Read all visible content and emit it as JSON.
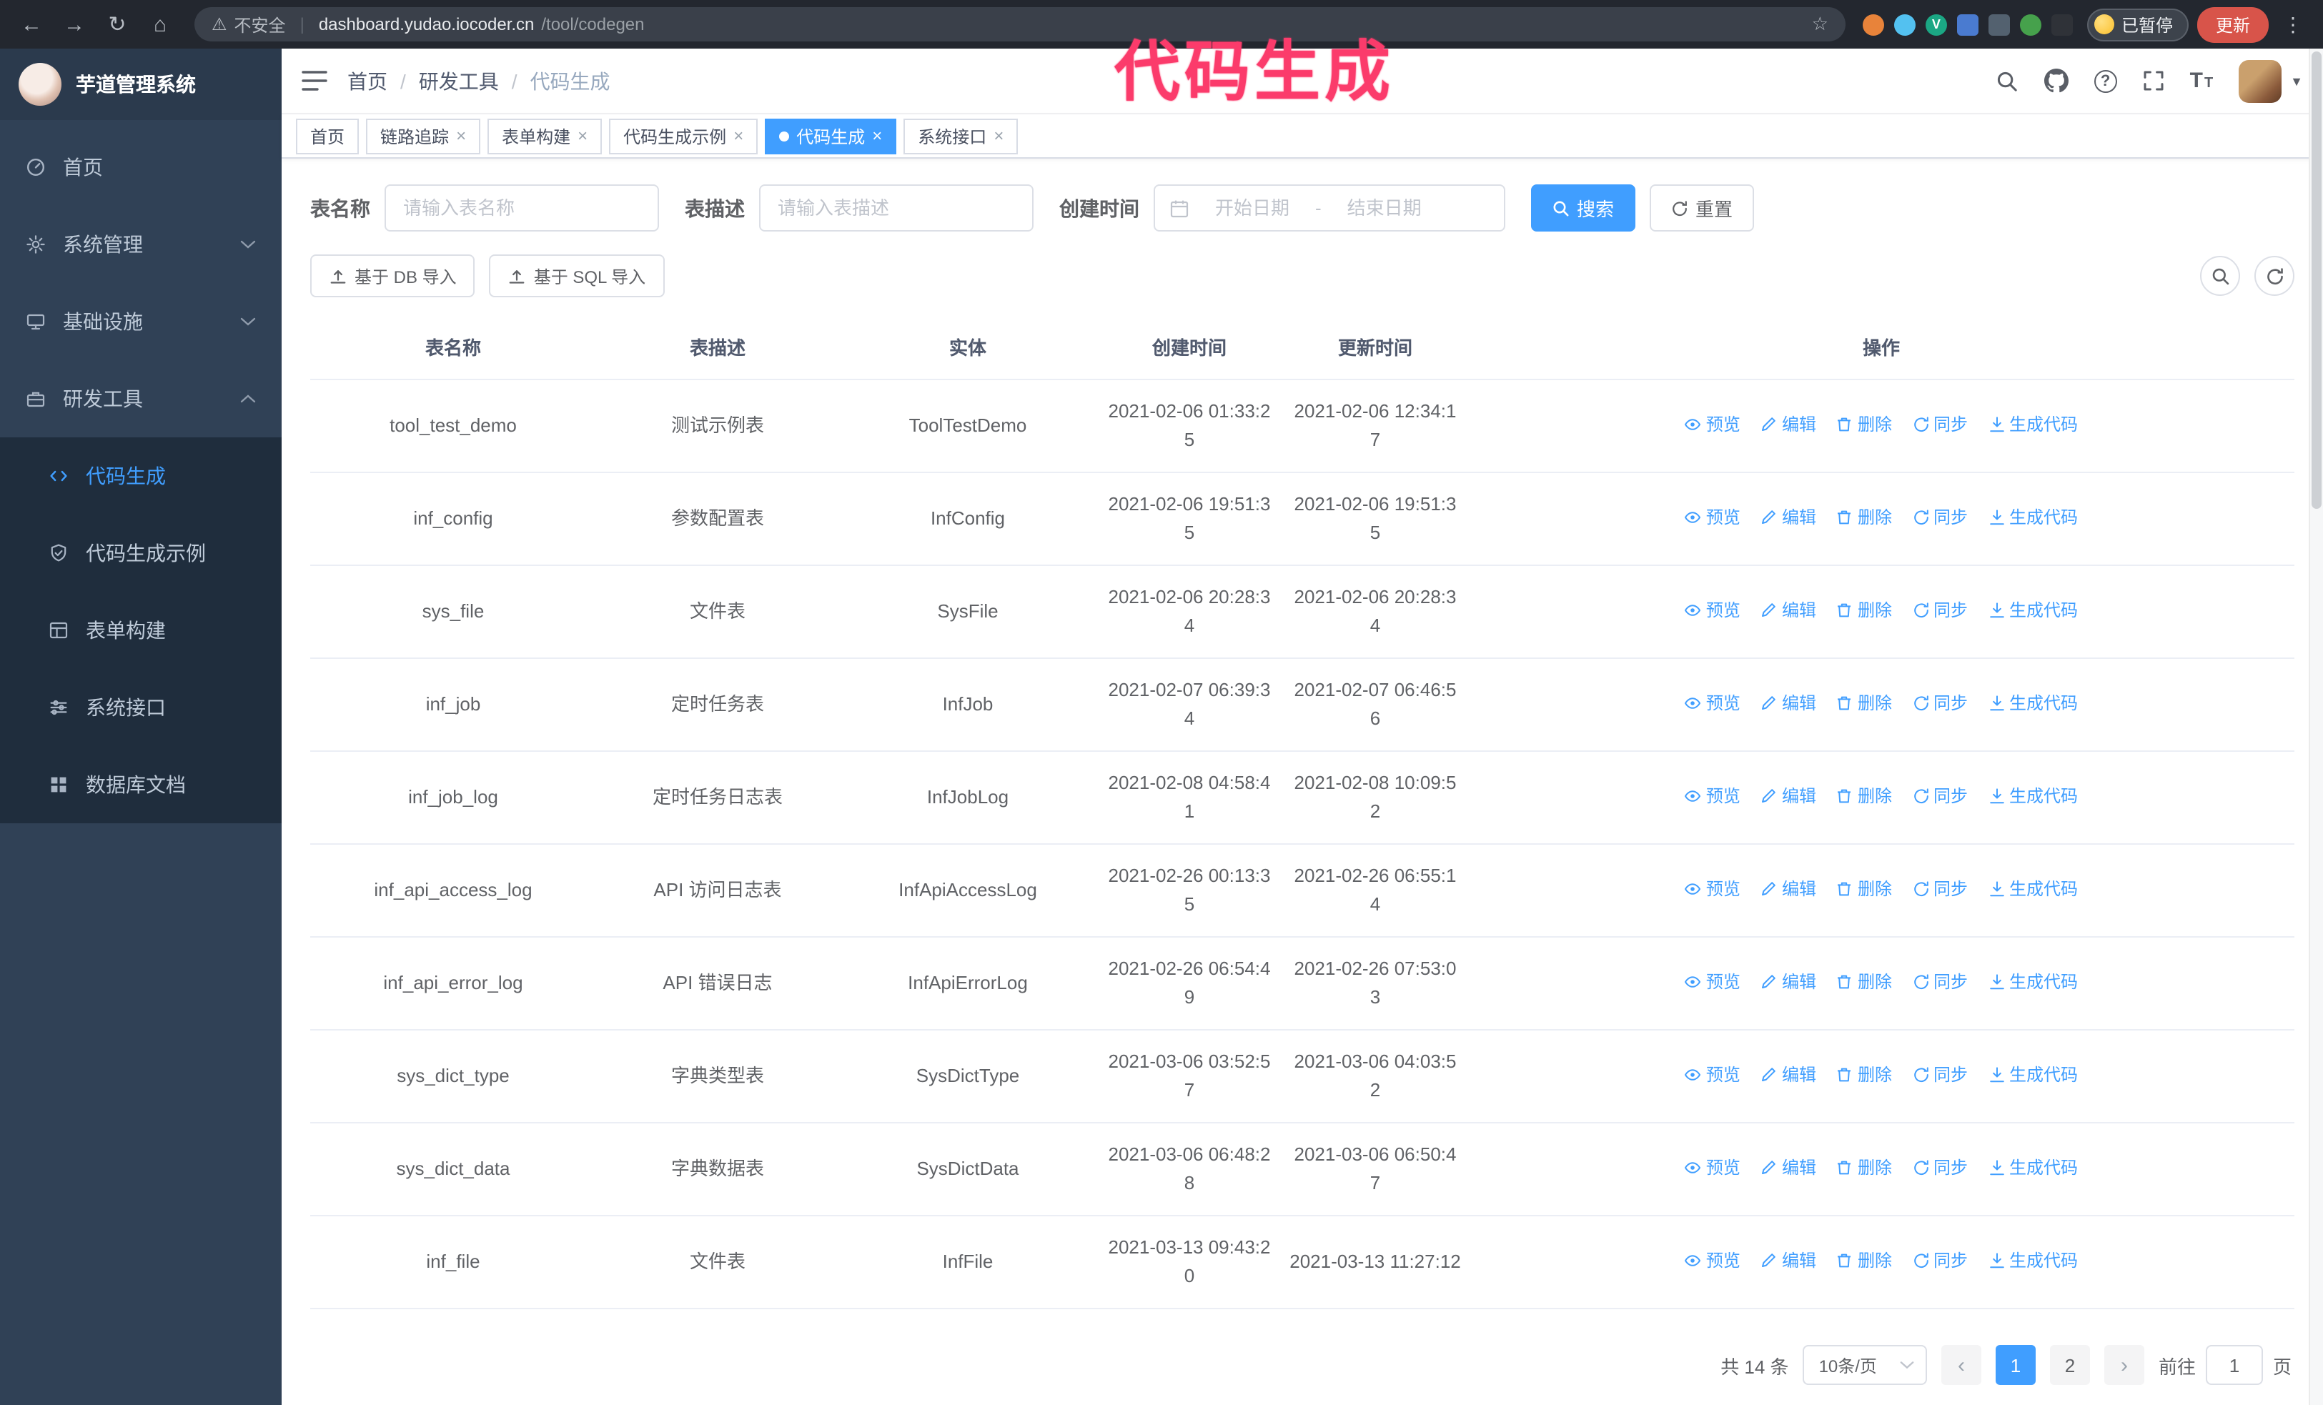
{
  "annotation": {
    "text": "代码生成",
    "color": "#fb3b6b"
  },
  "browser": {
    "security_label": "不安全",
    "url_domain": "dashboard.yudao.iocoder.cn",
    "url_path": "/tool/codegen",
    "paused_badge": "已暂停",
    "update_button": "更新"
  },
  "sidebar": {
    "logo_title": "芋道管理系统",
    "menu": [
      {
        "id": "home",
        "label": "首页",
        "icon": "dashboard-icon",
        "expandable": false
      },
      {
        "id": "system",
        "label": "系统管理",
        "icon": "gear-icon",
        "expandable": true,
        "open": false
      },
      {
        "id": "infra",
        "label": "基础设施",
        "icon": "monitor-icon",
        "expandable": true,
        "open": false
      },
      {
        "id": "dev-tools",
        "label": "研发工具",
        "icon": "toolbox-icon",
        "expandable": true,
        "open": true
      }
    ],
    "submenu": [
      {
        "id": "codegen",
        "label": "代码生成",
        "icon": "code-icon",
        "active": true
      },
      {
        "id": "codegen-example",
        "label": "代码生成示例",
        "icon": "shield-check-icon",
        "active": false
      },
      {
        "id": "form-builder",
        "label": "表单构建",
        "icon": "form-grid-icon",
        "active": false
      },
      {
        "id": "api",
        "label": "系统接口",
        "icon": "sliders-icon",
        "active": false
      },
      {
        "id": "db-doc",
        "label": "数据库文档",
        "icon": "grid-icon",
        "active": false
      }
    ]
  },
  "header": {
    "breadcrumb": [
      "首页",
      "研发工具",
      "代码生成"
    ]
  },
  "tabs": [
    {
      "id": "home",
      "label": "首页",
      "closable": false,
      "active": false
    },
    {
      "id": "tracing",
      "label": "链路追踪",
      "closable": true,
      "active": false
    },
    {
      "id": "form-builder",
      "label": "表单构建",
      "closable": true,
      "active": false
    },
    {
      "id": "codegen-example",
      "label": "代码生成示例",
      "closable": true,
      "active": false
    },
    {
      "id": "codegen",
      "label": "代码生成",
      "closable": true,
      "active": true
    },
    {
      "id": "api",
      "label": "系统接口",
      "closable": true,
      "active": false
    }
  ],
  "filters": {
    "table_name_label": "表名称",
    "table_name_placeholder": "请输入表名称",
    "table_desc_label": "表描述",
    "table_desc_placeholder": "请输入表描述",
    "create_time_label": "创建时间",
    "date_start_placeholder": "开始日期",
    "date_separator": "-",
    "date_end_placeholder": "结束日期",
    "search_button": "搜索",
    "reset_button": "重置"
  },
  "toolbar": {
    "import_db": "基于 DB 导入",
    "import_sql": "基于 SQL 导入"
  },
  "table": {
    "columns": [
      "表名称",
      "表描述",
      "实体",
      "创建时间",
      "更新时间",
      "操作"
    ],
    "actions": [
      {
        "name": "preview",
        "label": "预览",
        "icon": "eye-icon"
      },
      {
        "name": "edit",
        "label": "编辑",
        "icon": "edit-icon"
      },
      {
        "name": "delete",
        "label": "删除",
        "icon": "delete-icon"
      },
      {
        "name": "sync",
        "label": "同步",
        "icon": "sync-icon"
      },
      {
        "name": "generate-code",
        "label": "生成代码",
        "icon": "download-icon"
      }
    ],
    "rows": [
      {
        "name": "tool_test_demo",
        "desc": "测试示例表",
        "entity": "ToolTestDemo",
        "created": "2021-02-06 01:33:25",
        "updated": "2021-02-06 12:34:17"
      },
      {
        "name": "inf_config",
        "desc": "参数配置表",
        "entity": "InfConfig",
        "created": "2021-02-06 19:51:35",
        "updated": "2021-02-06 19:51:35"
      },
      {
        "name": "sys_file",
        "desc": "文件表",
        "entity": "SysFile",
        "created": "2021-02-06 20:28:34",
        "updated": "2021-02-06 20:28:34"
      },
      {
        "name": "inf_job",
        "desc": "定时任务表",
        "entity": "InfJob",
        "created": "2021-02-07 06:39:34",
        "updated": "2021-02-07 06:46:56"
      },
      {
        "name": "inf_job_log",
        "desc": "定时任务日志表",
        "entity": "InfJobLog",
        "created": "2021-02-08 04:58:41",
        "updated": "2021-02-08 10:09:52"
      },
      {
        "name": "inf_api_access_log",
        "desc": "API 访问日志表",
        "entity": "InfApiAccessLog",
        "created": "2021-02-26 00:13:35",
        "updated": "2021-02-26 06:55:14"
      },
      {
        "name": "inf_api_error_log",
        "desc": "API 错误日志",
        "entity": "InfApiErrorLog",
        "created": "2021-02-26 06:54:49",
        "updated": "2021-02-26 07:53:03"
      },
      {
        "name": "sys_dict_type",
        "desc": "字典类型表",
        "entity": "SysDictType",
        "created": "2021-03-06 03:52:57",
        "updated": "2021-03-06 04:03:52"
      },
      {
        "name": "sys_dict_data",
        "desc": "字典数据表",
        "entity": "SysDictData",
        "created": "2021-03-06 06:48:28",
        "updated": "2021-03-06 06:50:47"
      },
      {
        "name": "inf_file",
        "desc": "文件表",
        "entity": "InfFile",
        "created": "2021-03-13 09:43:20",
        "updated": "2021-03-13 11:27:12"
      }
    ]
  },
  "pagination": {
    "total": "共 14 条",
    "page_size": "10条/页",
    "pages": [
      "1",
      "2"
    ],
    "active_page": "1",
    "goto_label": "前往",
    "goto_value": "1",
    "goto_suffix": "页"
  },
  "colors": {
    "accent": "#409eff",
    "sidebar_bg": "#304156",
    "submenu_bg": "#1f2d3d",
    "annotation": "#fb3b6b"
  }
}
